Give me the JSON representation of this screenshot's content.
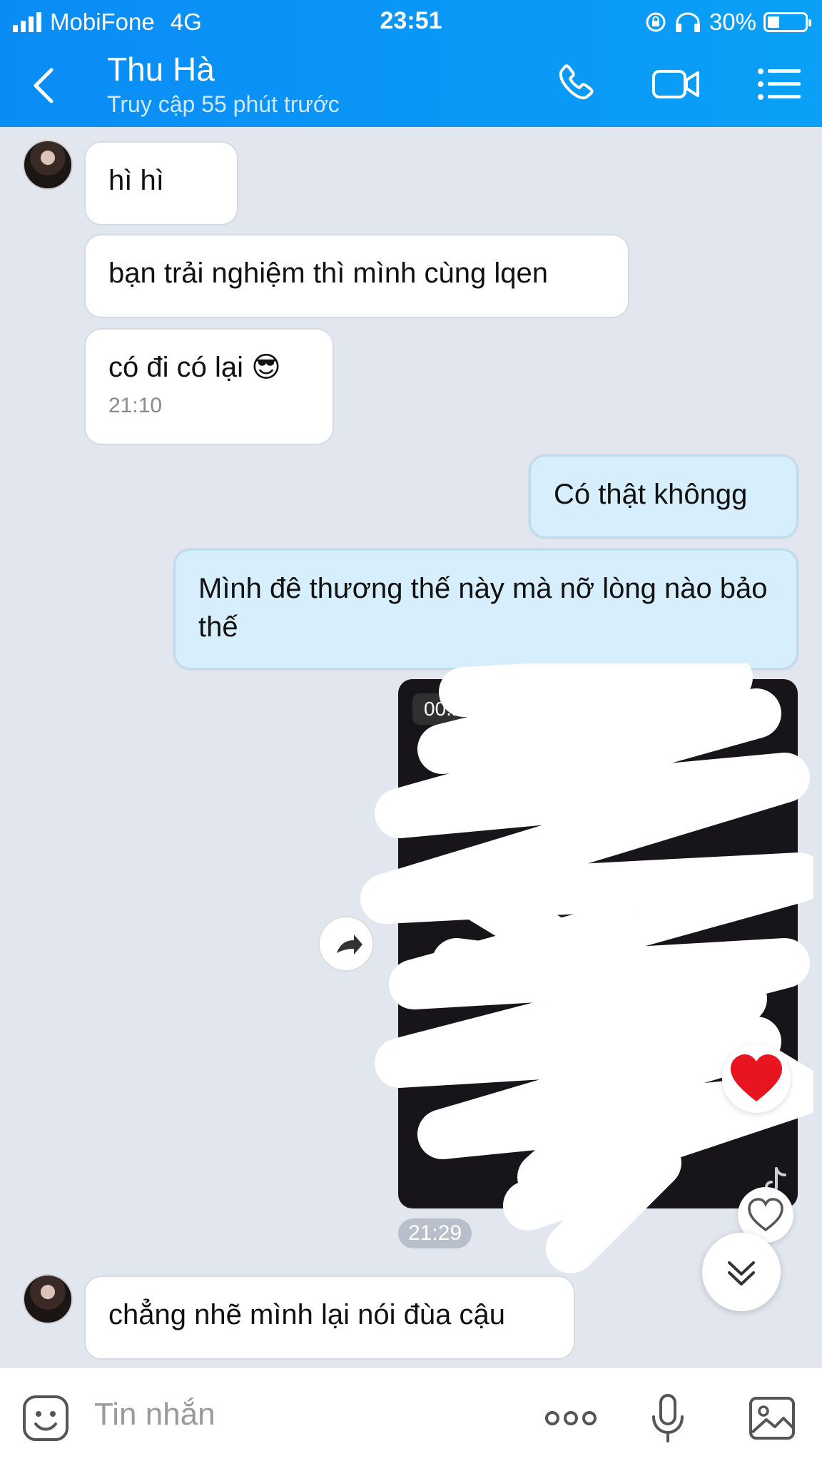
{
  "status_bar": {
    "carrier": "MobiFone",
    "network": "4G",
    "time": "23:51",
    "battery": "30%"
  },
  "header": {
    "name": "Thu Hà",
    "status": "Truy cập 55 phút trước"
  },
  "messages": [
    {
      "dir": "in",
      "text": "hì hì"
    },
    {
      "dir": "in",
      "text": "bạn trải nghiệm thì mình cùng lqen"
    },
    {
      "dir": "in",
      "text": "có đi có lại 😎",
      "time": "21:10"
    },
    {
      "dir": "out",
      "text": "Có thật khôngg"
    },
    {
      "dir": "out",
      "text": "Mình đê thương thế này mà nỡ lòng nào bảo thế"
    },
    {
      "dir": "out",
      "type": "video",
      "duration": "00:15",
      "reaction": "heart",
      "time": "21:29"
    },
    {
      "dir": "in",
      "text": "chẳng nhẽ mình lại nói đùa cậu"
    }
  ],
  "input": {
    "placeholder": "Tin nhắn"
  },
  "colors": {
    "header": "#0a8cf5",
    "outgoing_bubble": "#d7eefc",
    "background": "#e2e6ef"
  }
}
